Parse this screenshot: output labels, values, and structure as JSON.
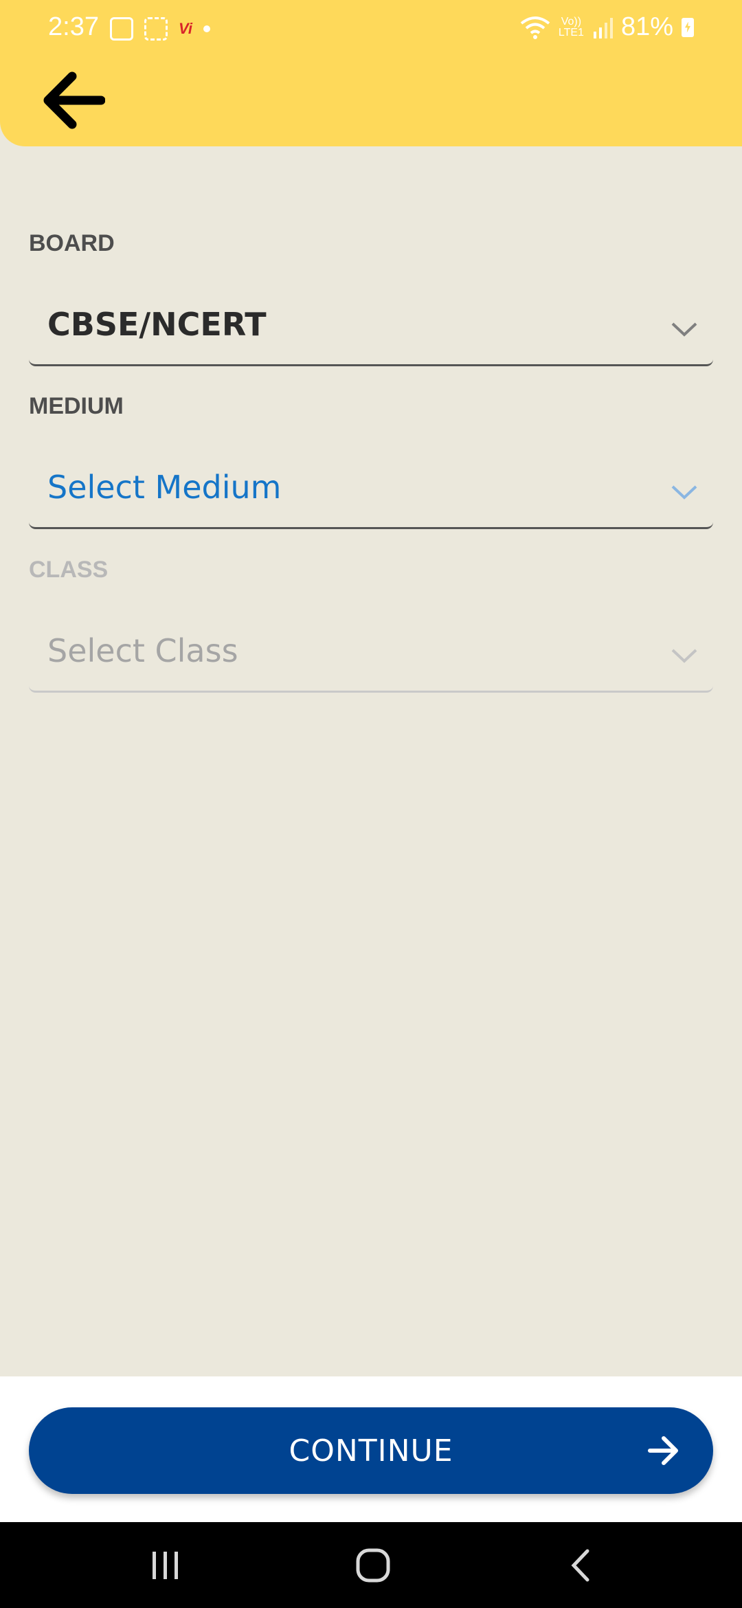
{
  "status_bar": {
    "time": "2:37",
    "carrier_badge": "Vi",
    "volte": "Vo))",
    "lte": "LTE1",
    "battery": "81%"
  },
  "header": {
    "back_icon": "arrow-left-icon",
    "background": "#fed95a"
  },
  "form": {
    "board": {
      "label": "BOARD",
      "value": "CBSE/NCERT"
    },
    "medium": {
      "label": "MEDIUM",
      "placeholder": "Select Medium"
    },
    "class": {
      "label": "CLASS",
      "placeholder": "Select Class"
    }
  },
  "continue_button": {
    "label": "CONTINUE",
    "icon": "arrow-right-icon",
    "color": "#004391"
  },
  "colors": {
    "background": "#ebe8dc",
    "accent_text": "#1575c8",
    "header": "#fed95a"
  },
  "nav_bar": {
    "recents_icon": "recents-icon",
    "home_icon": "home-icon",
    "back_icon": "back-chevron-icon"
  }
}
